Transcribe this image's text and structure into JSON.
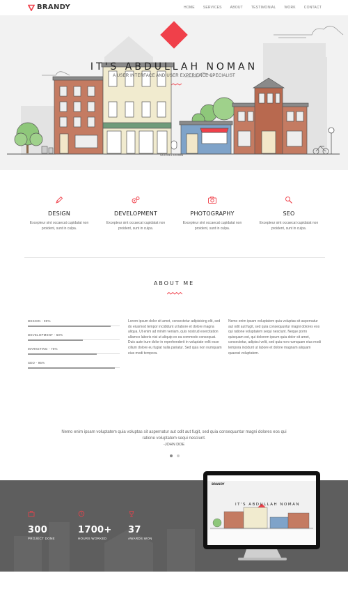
{
  "nav": {
    "brand": "BRANDY",
    "items": [
      "HOME",
      "SERVICES",
      "ABOUT",
      "TESTIMONIAL",
      "WORK",
      "CONTACT"
    ]
  },
  "hero": {
    "title": "IT'S ABDULLAH NOMAN",
    "subtitle": "A USER INTERFACE AND USER EXPERIENCE SPECIALIST",
    "scroll": "SCROLL DOWN"
  },
  "services": [
    {
      "icon": "pencil-icon",
      "title": "DESIGN",
      "text": "Excepteur sint occaecat cupidatat non proident, sunt in culpa."
    },
    {
      "icon": "gears-icon",
      "title": "DEVELOPMENT",
      "text": "Excepteur sint occaecat cupidatat non proident, sunt in culpa."
    },
    {
      "icon": "camera-icon",
      "title": "PHOTOGRAPHY",
      "text": "Excepteur sint occaecat cupidatat non proident, sunt in culpa."
    },
    {
      "icon": "magnifier-icon",
      "title": "SEO",
      "text": "Excepteur sint occaecat cupidatat non proident, sunt in culpa."
    }
  ],
  "about": {
    "title": "ABOUT ME",
    "skills": [
      {
        "label": "DESIGN - 90%",
        "value": 0.9
      },
      {
        "label": "DEVELOPMENT - 60%",
        "value": 0.6
      },
      {
        "label": "MARKETING - 75%",
        "value": 0.75
      },
      {
        "label": "SEO - 95%",
        "value": 0.95
      }
    ],
    "col1": "Lorem ipsum dolor sit amet, consectetur adipisicing elit, sed do eiusmod tempor incididunt ut labore et dolore magna aliqua. Ut enim ad minim veniam, quis nostrud exercitation ullamco laboris nisi ut aliquip ex ea commodo consequat. Duis aute irure dolor in reprehenderit in voluptate velit esse cillum dolore eu fugiat nulla pariatur. Sed quia non numquam eius modi tempora.",
    "col2": "Nemo enim ipsam voluptatem quia voluptas sit aspernatur aut odit aut fugit, sed quia consequuntur magni dolores eos qui ratione voluptatem sequi nesciunt. Neque porro quisquam est, qui dolorem ipsum quia dolor sit amet, consectetur, adipisci velit, sed quia non numquam eius modi tempora incidunt ut labore et dolore magnam aliquam quaerat voluptatem."
  },
  "testimonial": {
    "quote": "Nemo enim ipsam voluptatem quia voluptas sit aspernatur aut odit aut fugit, sed quia consequuntur magni dolores eos qui ratione voluptatem sequi nesciunt.",
    "author": "-JOHN DOE",
    "active_slide": 1,
    "slide_count": 2
  },
  "stats": [
    {
      "icon": "briefcase-icon",
      "number": "300",
      "label": "PROJECT DONE"
    },
    {
      "icon": "clock-icon",
      "number": "1700+",
      "label": "HOURS WORKED"
    },
    {
      "icon": "trophy-icon",
      "number": "37",
      "label": "AWARDS WON"
    }
  ],
  "monitor": {
    "brand": "BRANDY",
    "title": "IT'S ABDULLAH NOMAN"
  },
  "colors": {
    "accent": "#f0404a",
    "band": "#5e5e5e",
    "hero_bg": "#f2f2f2"
  }
}
